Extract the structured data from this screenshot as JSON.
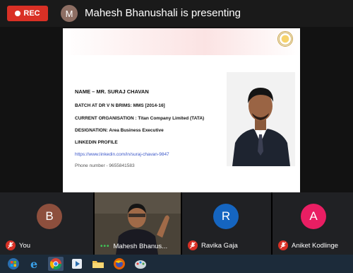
{
  "topbar": {
    "rec_label": "REC",
    "presenter_initial": "M",
    "presenting_text": "Mahesh Bhanushali is presenting"
  },
  "slide": {
    "name": "NAME – MR. SURAJ CHAVAN",
    "batch": "BATCH AT DR V N BRIMS: MMS [2014-16]",
    "organisation": "CURRENT ORGANISATION : Titan Company Limited (TATA)",
    "designation": "DESIGNATION: Area Business Executive",
    "linkedin_label": "LINKEDIN PROFILE",
    "linkedin_url": "https://www.linkedin.com/in/suraj-chavan-9847",
    "phone": "Phone number - 9655841583"
  },
  "participants": [
    {
      "initial": "B",
      "name": "You",
      "avatar_color": "#8d4f3d"
    },
    {
      "initial": "",
      "name": "Mahesh Bhanus...",
      "avatar_color": ""
    },
    {
      "initial": "R",
      "name": "Ravika Gaja",
      "avatar_color": "#1565c0"
    },
    {
      "initial": "A",
      "name": "Aniket Kodlinge",
      "avatar_color": "#e91e63"
    }
  ],
  "taskbar": {
    "icons": [
      "start-icon",
      "ie-icon",
      "chrome-icon",
      "media-player-icon",
      "explorer-icon",
      "firefox-icon",
      "paint-icon"
    ]
  },
  "colors": {
    "rec": "#d93025",
    "mic_off": "#d93025",
    "tile_bg": "#202124",
    "link": "#3a56c8"
  }
}
